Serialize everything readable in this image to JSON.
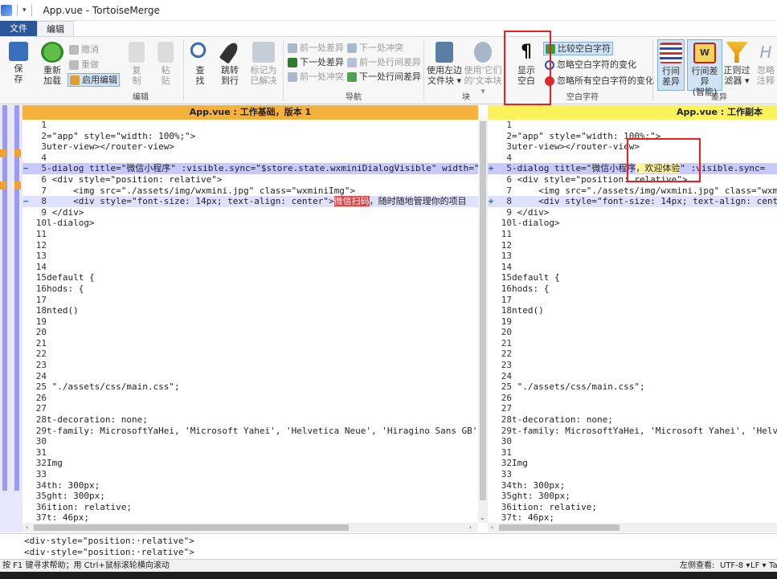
{
  "window": {
    "title": "App.vue - TortoiseMerge"
  },
  "tabs": {
    "file": "文件",
    "edit": "编辑"
  },
  "ribbon": {
    "save": [
      "保",
      "存"
    ],
    "reload": [
      "重新",
      "加载"
    ],
    "undo": "撤消",
    "redo": "重做",
    "enable_edit": "启用编辑",
    "copy": [
      "复",
      "制"
    ],
    "paste": [
      "粘",
      "贴"
    ],
    "group_edit": "编辑",
    "find": [
      "查",
      "找"
    ],
    "goto_line": [
      "跳转",
      "到行"
    ],
    "mark_resolved": [
      "标记为",
      "已解决"
    ],
    "prev_diff": "前一处差异",
    "next_diff": "下一处差异",
    "prev_conflict": "前一处冲突",
    "next_conflict": "下一处冲突",
    "prev_inline": "前一处行间差异",
    "next_inline": "下一处行间差异",
    "group_nav": "导航",
    "use_left_block": [
      "使用左边",
      "文件块 ▾"
    ],
    "use_their_block": [
      "使用'它们",
      "的'文本块 ▾"
    ],
    "group_block": "块",
    "show_whitespace": [
      "显示",
      "空白"
    ],
    "compare_whitespace": "比较空白字符",
    "ignore_ws_changes": "忽略空白字符的变化",
    "ignore_all_ws": "忽略所有空白字符的变化",
    "group_whitespace": "空白字符",
    "inline_diff": [
      "行间",
      "差异"
    ],
    "inline_diff_smart": [
      "行间差异",
      "(智能)"
    ],
    "regex_filter": [
      "正则过",
      "滤器 ▾"
    ],
    "ignore_comments": [
      "忽略",
      "注释"
    ],
    "group_diff": "差异"
  },
  "left_pane": {
    "header": "App.vue : 工作基础，版本 1",
    "lines": [
      {
        "n": "1",
        "m": "",
        "t": "",
        "c": ""
      },
      {
        "n": "2",
        "m": "",
        "t": "=\"app\" style=\"width: 100%;\">",
        "c": ""
      },
      {
        "n": "3",
        "m": "",
        "t": "uter-view></router-view>",
        "c": ""
      },
      {
        "n": "4",
        "m": "",
        "t": "",
        "c": ""
      },
      {
        "n": "5",
        "m": "−",
        "t": "-dialog title=\"微信小程序\" :visible.sync=\"$store.state.wxminiDialogVisible\" width=\"",
        "c": "changed"
      },
      {
        "n": "6",
        "m": "",
        "t": " <div style=\"position: relative\">",
        "c": ""
      },
      {
        "n": "7",
        "m": "",
        "t": "     <img src=\"./assets/img/wxmini.jpg\" class=\"wxminiImg\">",
        "c": ""
      },
      {
        "n": "8",
        "m": "−",
        "t": "     <div style=\"font-size: 14px; text-align: center\">",
        "hl": "微信扫码",
        "t2": "，随时随地管理你的项目",
        "c": "changed2"
      },
      {
        "n": "9",
        "m": "",
        "t": " </div>",
        "c": ""
      },
      {
        "n": "10",
        "m": "",
        "t": "l-dialog>",
        "c": ""
      },
      {
        "n": "11",
        "m": "",
        "t": "",
        "c": ""
      },
      {
        "n": "12",
        "m": "",
        "t": "",
        "c": ""
      },
      {
        "n": "13",
        "m": "",
        "t": "",
        "c": ""
      },
      {
        "n": "14",
        "m": "",
        "t": "",
        "c": ""
      },
      {
        "n": "15",
        "m": "",
        "t": "default {",
        "c": ""
      },
      {
        "n": "16",
        "m": "",
        "t": "hods: {",
        "c": ""
      },
      {
        "n": "17",
        "m": "",
        "t": "",
        "c": ""
      },
      {
        "n": "18",
        "m": "",
        "t": "nted()",
        "c": ""
      },
      {
        "n": "19",
        "m": "",
        "t": "",
        "c": ""
      },
      {
        "n": "20",
        "m": "",
        "t": "",
        "c": ""
      },
      {
        "n": "21",
        "m": "",
        "t": "",
        "c": ""
      },
      {
        "n": "22",
        "m": "",
        "t": "",
        "c": ""
      },
      {
        "n": "23",
        "m": "",
        "t": "",
        "c": ""
      },
      {
        "n": "24",
        "m": "",
        "t": "",
        "c": ""
      },
      {
        "n": "25",
        "m": "",
        "t": " \"./assets/css/main.css\";",
        "c": ""
      },
      {
        "n": "26",
        "m": "",
        "t": "",
        "c": ""
      },
      {
        "n": "27",
        "m": "",
        "t": "",
        "c": ""
      },
      {
        "n": "28",
        "m": "",
        "t": "t-decoration: none;",
        "c": ""
      },
      {
        "n": "29",
        "m": "",
        "t": "t-family: MicrosoftYaHei, 'Microsoft Yahei', 'Helvetica Neue', 'Hiragino Sans GB', ",
        "c": ""
      },
      {
        "n": "30",
        "m": "",
        "t": "",
        "c": ""
      },
      {
        "n": "31",
        "m": "",
        "t": "",
        "c": ""
      },
      {
        "n": "32",
        "m": "",
        "t": "Img",
        "c": ""
      },
      {
        "n": "33",
        "m": "",
        "t": "",
        "c": ""
      },
      {
        "n": "34",
        "m": "",
        "t": "th: 300px;",
        "c": ""
      },
      {
        "n": "35",
        "m": "",
        "t": "ght: 300px;",
        "c": ""
      },
      {
        "n": "36",
        "m": "",
        "t": "ition: relative;",
        "c": ""
      },
      {
        "n": "37",
        "m": "",
        "t": "t: 46px;",
        "c": ""
      }
    ]
  },
  "right_pane": {
    "header": "App.vue : 工作副本",
    "lines": [
      {
        "n": "1",
        "m": "",
        "t": "",
        "c": ""
      },
      {
        "n": "2",
        "m": "",
        "t": "=\"app\" style=\"width: 100%;\">",
        "c": ""
      },
      {
        "n": "3",
        "m": "",
        "t": "uter-view></router-view>",
        "c": ""
      },
      {
        "n": "4",
        "m": "",
        "t": "",
        "c": ""
      },
      {
        "n": "5",
        "m": "+",
        "t": "-dialog title=\"微信小程序",
        "hl": "，欢迎体验",
        "t2": "\" :visible.sync=",
        "c": "changed"
      },
      {
        "n": "6",
        "m": "",
        "t": " <div style=\"position: relative\">",
        "c": ""
      },
      {
        "n": "7",
        "m": "",
        "t": "     <img src=\"./assets/img/wxmini.jpg\" class=\"wxmi",
        "c": ""
      },
      {
        "n": "8",
        "m": "+",
        "t": "     <div style=\"font-size: 14px; text-align: cente",
        "c": "changed2"
      },
      {
        "n": "9",
        "m": "",
        "t": " </div>",
        "c": ""
      },
      {
        "n": "10",
        "m": "",
        "t": "l-dialog>",
        "c": ""
      },
      {
        "n": "11",
        "m": "",
        "t": "",
        "c": ""
      },
      {
        "n": "12",
        "m": "",
        "t": "",
        "c": ""
      },
      {
        "n": "13",
        "m": "",
        "t": "",
        "c": ""
      },
      {
        "n": "14",
        "m": "",
        "t": "",
        "c": ""
      },
      {
        "n": "15",
        "m": "",
        "t": "default {",
        "c": ""
      },
      {
        "n": "16",
        "m": "",
        "t": "hods: {",
        "c": ""
      },
      {
        "n": "17",
        "m": "",
        "t": "",
        "c": ""
      },
      {
        "n": "18",
        "m": "",
        "t": "nted()",
        "c": ""
      },
      {
        "n": "19",
        "m": "",
        "t": "",
        "c": ""
      },
      {
        "n": "20",
        "m": "",
        "t": "",
        "c": ""
      },
      {
        "n": "21",
        "m": "",
        "t": "",
        "c": ""
      },
      {
        "n": "22",
        "m": "",
        "t": "",
        "c": ""
      },
      {
        "n": "23",
        "m": "",
        "t": "",
        "c": ""
      },
      {
        "n": "24",
        "m": "",
        "t": "",
        "c": ""
      },
      {
        "n": "25",
        "m": "",
        "t": " \"./assets/css/main.css\";",
        "c": ""
      },
      {
        "n": "26",
        "m": "",
        "t": "",
        "c": ""
      },
      {
        "n": "27",
        "m": "",
        "t": "",
        "c": ""
      },
      {
        "n": "28",
        "m": "",
        "t": "t-decoration: none;",
        "c": ""
      },
      {
        "n": "29",
        "m": "",
        "t": "t-family: MicrosoftYaHei, 'Microsoft Yahei', 'Helve",
        "c": ""
      },
      {
        "n": "30",
        "m": "",
        "t": "",
        "c": ""
      },
      {
        "n": "31",
        "m": "",
        "t": "",
        "c": ""
      },
      {
        "n": "32",
        "m": "",
        "t": "Img",
        "c": ""
      },
      {
        "n": "33",
        "m": "",
        "t": "",
        "c": ""
      },
      {
        "n": "34",
        "m": "",
        "t": "th: 300px;",
        "c": ""
      },
      {
        "n": "35",
        "m": "",
        "t": "ght: 300px;",
        "c": ""
      },
      {
        "n": "36",
        "m": "",
        "t": "ition: relative;",
        "c": ""
      },
      {
        "n": "37",
        "m": "",
        "t": "t: 46px;",
        "c": ""
      }
    ]
  },
  "bottom_diff": [
    "<div·style=\"position:·relative\">",
    "<div·style=\"position:·relative\">"
  ],
  "status": {
    "help": "按 F1 键寻求帮助；用 Ctrl+鼠标滚轮横向滚动",
    "view": "左侧查看:",
    "encoding": "UTF-8 ▾",
    "eol": "LF ▾",
    "tab": "Ta"
  },
  "colors": {
    "accent": "#2b579a",
    "left_header": "#f4b13c",
    "right_header": "#f9f25a",
    "diff_line": "#c9c9ff",
    "annotation": "#e82020"
  }
}
